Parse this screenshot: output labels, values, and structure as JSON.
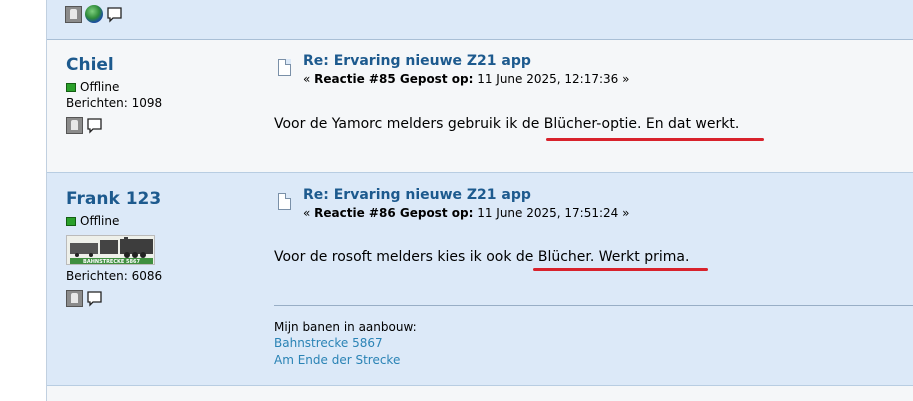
{
  "posts": [
    {
      "author": "Chiel",
      "status": "Offline",
      "posts_count": "Berichten: 1098",
      "title": "Re: Ervaring nieuwe Z21 app",
      "meta_label": "Reactie #85 Gepost op:",
      "meta_date": "11 June 2025, 12:17:36",
      "meta_prefix": "«",
      "meta_suffix": "»",
      "body": "Voor de Yamorc melders gebruik ik de Blücher-optie. En dat werkt."
    },
    {
      "author": "Frank 123",
      "status": "Offline",
      "posts_count": "Berichten: 6086",
      "avatar_text": "BAHNSTRECKE 5867",
      "title": "Re: Ervaring nieuwe Z21 app",
      "meta_label": "Reactie #86 Gepost op:",
      "meta_date": "11 June 2025, 17:51:24",
      "meta_prefix": "«",
      "meta_suffix": "»",
      "body": "Voor de rosoft melders kies ik ook de Blücher. Werkt prima.",
      "signature": {
        "label": "Mijn banen in aanbouw:",
        "links": [
          "Bahnstrecke 5867",
          "Am Ende der Strecke"
        ]
      }
    }
  ],
  "colors": {
    "link": "#1d5a8e",
    "highlight": "#d8222c",
    "row_blue": "#dce9f8"
  }
}
